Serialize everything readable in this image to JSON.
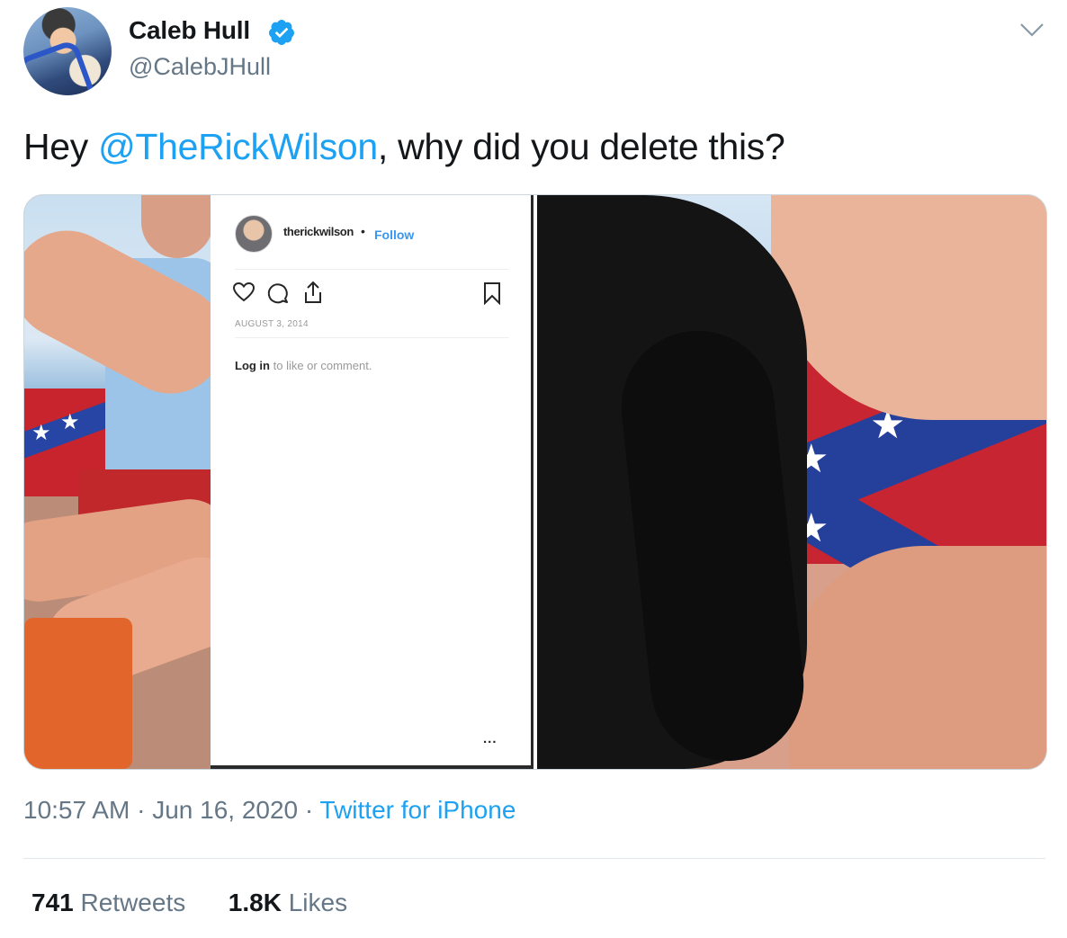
{
  "author": {
    "display_name": "Caleb Hull",
    "handle": "@CalebJHull",
    "verified": true,
    "verified_icon": "verified-badge-icon"
  },
  "tweet": {
    "text_before": "Hey ",
    "mention": "@TheRickWilson",
    "text_after": ", why did you delete this?"
  },
  "instagram_card": {
    "username": "therickwilson",
    "separator": "•",
    "follow_label": "Follow",
    "date": "AUGUST 3, 2014",
    "login_link": "Log in",
    "login_rest": " to like or comment.",
    "more_label": "..."
  },
  "meta": {
    "time": "10:57 AM",
    "date": "Jun 16, 2020",
    "sep": "·",
    "source": "Twitter for iPhone"
  },
  "stats": {
    "retweets_count": "741",
    "retweets_label": "Retweets",
    "likes_count": "1.8K",
    "likes_label": "Likes"
  },
  "colors": {
    "link": "#1da1f2",
    "muted": "#657786",
    "text": "#14171a"
  }
}
